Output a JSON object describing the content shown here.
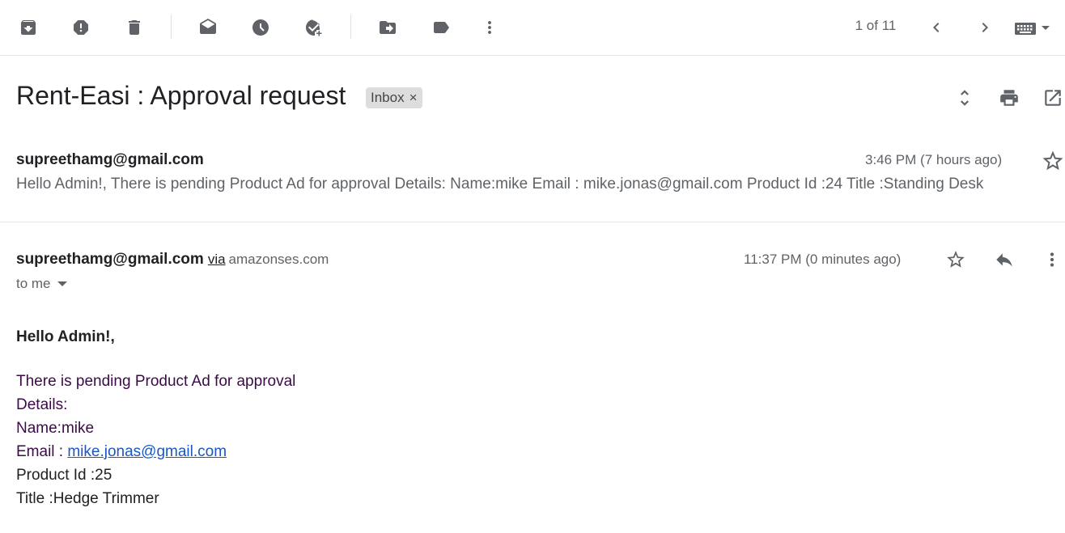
{
  "toolbar": {
    "pager_text": "1 of 11",
    "buttons": [
      "archive-icon",
      "report-spam-icon",
      "delete-icon",
      "mark-unread-icon",
      "snooze-icon",
      "add-to-tasks-icon",
      "move-to-icon",
      "label-icon",
      "more-vert-icon"
    ]
  },
  "thread": {
    "subject": "Rent-Easi : Approval request",
    "label": "Inbox",
    "label_close": "×"
  },
  "message1": {
    "sender": "supreethamg@gmail.com",
    "time": "3:46 PM (7 hours ago)",
    "snippet": "Hello Admin!, There is pending Product Ad for approval Details: Name:mike Email : mike.jonas@gmail.com Product Id :24 Title :Standing Desk"
  },
  "message2": {
    "sender": "supreethamg@gmail.com",
    "via": "via",
    "via_domain": "amazonses.com",
    "time": "11:37 PM (0 minutes ago)",
    "recipient": "to me",
    "body": {
      "greeting": "Hello Admin!,",
      "line1": "There is pending Product Ad for approval",
      "line2": "Details:",
      "line3": "Name:mike",
      "email_prefix": "Email : ",
      "email_link": "mike.jonas@gmail.com",
      "line5": "Product Id :25",
      "line6": "Title :Hedge Trimmer"
    }
  },
  "colors": {
    "body_text": "#3c0a49",
    "link": "#1a57c4",
    "icon": "#5f6368",
    "chip_bg": "#dddddd"
  }
}
